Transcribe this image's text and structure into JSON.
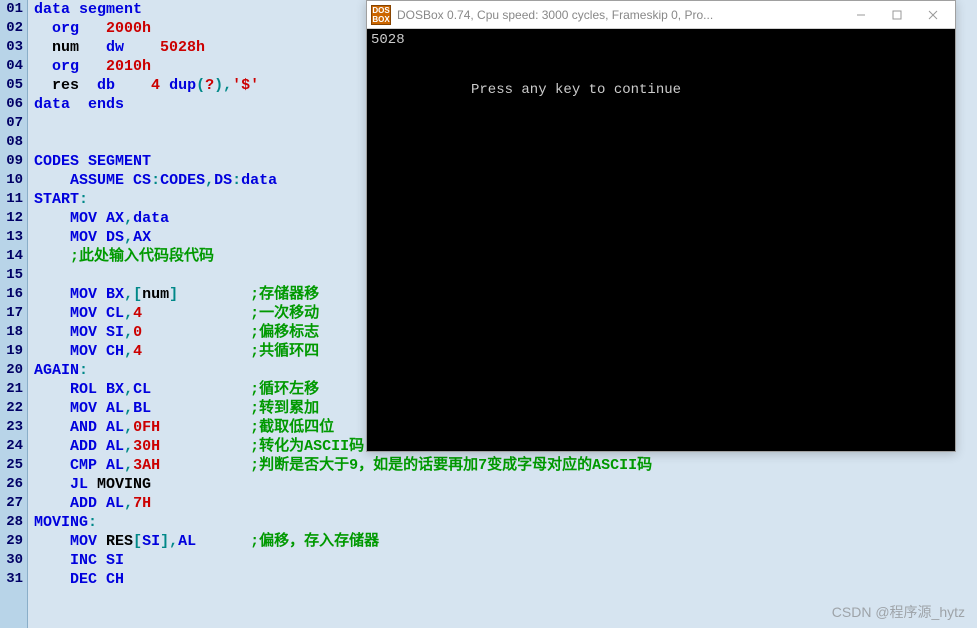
{
  "lines": [
    {
      "n": "01",
      "segs": [
        {
          "c": "kw-blue",
          "t": "data"
        },
        {
          "t": " "
        },
        {
          "c": "kw-blue",
          "t": "segment"
        }
      ]
    },
    {
      "n": "02",
      "segs": [
        {
          "t": "  "
        },
        {
          "c": "kw-blue",
          "t": "org"
        },
        {
          "t": "   "
        },
        {
          "c": "num-red",
          "t": "2000h"
        }
      ]
    },
    {
      "n": "03",
      "segs": [
        {
          "t": "  num   "
        },
        {
          "c": "kw-blue",
          "t": "dw"
        },
        {
          "t": "    "
        },
        {
          "c": "num-red",
          "t": "5028h"
        }
      ]
    },
    {
      "n": "04",
      "segs": [
        {
          "t": "  "
        },
        {
          "c": "kw-blue",
          "t": "org"
        },
        {
          "t": "   "
        },
        {
          "c": "num-red",
          "t": "2010h"
        }
      ]
    },
    {
      "n": "05",
      "segs": [
        {
          "t": "  res  "
        },
        {
          "c": "kw-blue",
          "t": "db"
        },
        {
          "t": "    "
        },
        {
          "c": "num-red",
          "t": "4"
        },
        {
          "t": " "
        },
        {
          "c": "kw-blue",
          "t": "dup"
        },
        {
          "c": "kw-teal",
          "t": "("
        },
        {
          "c": "str-red",
          "t": "?"
        },
        {
          "c": "kw-teal",
          "t": ")"
        },
        {
          "c": "kw-teal",
          "t": ","
        },
        {
          "c": "str-red",
          "t": "'$'"
        }
      ]
    },
    {
      "n": "06",
      "segs": [
        {
          "c": "kw-blue",
          "t": "data"
        },
        {
          "t": "  "
        },
        {
          "c": "kw-blue",
          "t": "ends"
        }
      ]
    },
    {
      "n": "07",
      "segs": [
        {
          "t": ""
        }
      ]
    },
    {
      "n": "08",
      "segs": [
        {
          "t": ""
        }
      ]
    },
    {
      "n": "09",
      "segs": [
        {
          "c": "kw-blue",
          "t": "CODES"
        },
        {
          "t": " "
        },
        {
          "c": "kw-blue",
          "t": "SEGMENT"
        }
      ]
    },
    {
      "n": "10",
      "segs": [
        {
          "t": "    "
        },
        {
          "c": "kw-blue",
          "t": "ASSUME"
        },
        {
          "t": " "
        },
        {
          "c": "kw-blue",
          "t": "CS"
        },
        {
          "c": "kw-teal",
          "t": ":"
        },
        {
          "c": "kw-blue",
          "t": "CODES"
        },
        {
          "c": "kw-teal",
          "t": ","
        },
        {
          "c": "kw-blue",
          "t": "DS"
        },
        {
          "c": "kw-teal",
          "t": ":"
        },
        {
          "c": "kw-blue",
          "t": "data"
        }
      ]
    },
    {
      "n": "11",
      "segs": [
        {
          "c": "kw-blue",
          "t": "START"
        },
        {
          "c": "kw-teal",
          "t": ":"
        }
      ]
    },
    {
      "n": "12",
      "segs": [
        {
          "t": "    "
        },
        {
          "c": "kw-blue",
          "t": "MOV"
        },
        {
          "t": " "
        },
        {
          "c": "kw-blue",
          "t": "AX"
        },
        {
          "c": "kw-teal",
          "t": ","
        },
        {
          "c": "kw-blue",
          "t": "data"
        }
      ]
    },
    {
      "n": "13",
      "segs": [
        {
          "t": "    "
        },
        {
          "c": "kw-blue",
          "t": "MOV"
        },
        {
          "t": " "
        },
        {
          "c": "kw-blue",
          "t": "DS"
        },
        {
          "c": "kw-teal",
          "t": ","
        },
        {
          "c": "kw-blue",
          "t": "AX"
        }
      ]
    },
    {
      "n": "14",
      "segs": [
        {
          "t": "    "
        },
        {
          "c": "cmt",
          "t": ";此处输入代码段代码"
        }
      ]
    },
    {
      "n": "15",
      "segs": [
        {
          "t": ""
        }
      ]
    },
    {
      "n": "16",
      "segs": [
        {
          "t": "    "
        },
        {
          "c": "kw-blue",
          "t": "MOV"
        },
        {
          "t": " "
        },
        {
          "c": "kw-blue",
          "t": "BX"
        },
        {
          "c": "kw-teal",
          "t": ",["
        },
        {
          "t": "num"
        },
        {
          "c": "kw-teal",
          "t": "]"
        },
        {
          "t": "        "
        },
        {
          "c": "cmt",
          "t": ";存储器移"
        }
      ]
    },
    {
      "n": "17",
      "segs": [
        {
          "t": "    "
        },
        {
          "c": "kw-blue",
          "t": "MOV"
        },
        {
          "t": " "
        },
        {
          "c": "kw-blue",
          "t": "CL"
        },
        {
          "c": "kw-teal",
          "t": ","
        },
        {
          "c": "num-red",
          "t": "4"
        },
        {
          "t": "            "
        },
        {
          "c": "cmt",
          "t": ";一次移动"
        }
      ]
    },
    {
      "n": "18",
      "segs": [
        {
          "t": "    "
        },
        {
          "c": "kw-blue",
          "t": "MOV"
        },
        {
          "t": " "
        },
        {
          "c": "kw-blue",
          "t": "SI"
        },
        {
          "c": "kw-teal",
          "t": ","
        },
        {
          "c": "num-red",
          "t": "0"
        },
        {
          "t": "            "
        },
        {
          "c": "cmt",
          "t": ";偏移标志"
        }
      ]
    },
    {
      "n": "19",
      "segs": [
        {
          "t": "    "
        },
        {
          "c": "kw-blue",
          "t": "MOV"
        },
        {
          "t": " "
        },
        {
          "c": "kw-blue",
          "t": "CH"
        },
        {
          "c": "kw-teal",
          "t": ","
        },
        {
          "c": "num-red",
          "t": "4"
        },
        {
          "t": "            "
        },
        {
          "c": "cmt",
          "t": ";共循环四"
        }
      ]
    },
    {
      "n": "20",
      "segs": [
        {
          "c": "kw-blue",
          "t": "AGAIN"
        },
        {
          "c": "kw-teal",
          "t": ":"
        }
      ]
    },
    {
      "n": "21",
      "segs": [
        {
          "t": "    "
        },
        {
          "c": "kw-blue",
          "t": "ROL"
        },
        {
          "t": " "
        },
        {
          "c": "kw-blue",
          "t": "BX"
        },
        {
          "c": "kw-teal",
          "t": ","
        },
        {
          "c": "kw-blue",
          "t": "CL"
        },
        {
          "t": "           "
        },
        {
          "c": "cmt",
          "t": ";循环左移"
        }
      ]
    },
    {
      "n": "22",
      "segs": [
        {
          "t": "    "
        },
        {
          "c": "kw-blue",
          "t": "MOV"
        },
        {
          "t": " "
        },
        {
          "c": "kw-blue",
          "t": "AL"
        },
        {
          "c": "kw-teal",
          "t": ","
        },
        {
          "c": "kw-blue",
          "t": "BL"
        },
        {
          "t": "           "
        },
        {
          "c": "cmt",
          "t": ";转到累加"
        }
      ]
    },
    {
      "n": "23",
      "segs": [
        {
          "t": "    "
        },
        {
          "c": "kw-blue",
          "t": "AND"
        },
        {
          "t": " "
        },
        {
          "c": "kw-blue",
          "t": "AL"
        },
        {
          "c": "kw-teal",
          "t": ","
        },
        {
          "c": "num-red",
          "t": "0FH"
        },
        {
          "t": "          "
        },
        {
          "c": "cmt",
          "t": ";截取低四位"
        }
      ]
    },
    {
      "n": "24",
      "segs": [
        {
          "t": "    "
        },
        {
          "c": "kw-blue",
          "t": "ADD"
        },
        {
          "t": " "
        },
        {
          "c": "kw-blue",
          "t": "AL"
        },
        {
          "c": "kw-teal",
          "t": ","
        },
        {
          "c": "num-red",
          "t": "30H"
        },
        {
          "t": "          "
        },
        {
          "c": "cmt",
          "t": ";转化为ASCII码"
        }
      ]
    },
    {
      "n": "25",
      "segs": [
        {
          "t": "    "
        },
        {
          "c": "kw-blue",
          "t": "CMP"
        },
        {
          "t": " "
        },
        {
          "c": "kw-blue",
          "t": "AL"
        },
        {
          "c": "kw-teal",
          "t": ","
        },
        {
          "c": "num-red",
          "t": "3AH"
        },
        {
          "t": "          "
        },
        {
          "c": "cmt",
          "t": ";判断是否大于9，如是的话要再加7变成字母对应的ASCII码"
        }
      ]
    },
    {
      "n": "26",
      "segs": [
        {
          "t": "    "
        },
        {
          "c": "kw-blue",
          "t": "JL"
        },
        {
          "t": " MOVING"
        }
      ]
    },
    {
      "n": "27",
      "segs": [
        {
          "t": "    "
        },
        {
          "c": "kw-blue",
          "t": "ADD"
        },
        {
          "t": " "
        },
        {
          "c": "kw-blue",
          "t": "AL"
        },
        {
          "c": "kw-teal",
          "t": ","
        },
        {
          "c": "num-red",
          "t": "7H"
        }
      ]
    },
    {
      "n": "28",
      "segs": [
        {
          "c": "kw-blue",
          "t": "MOVING"
        },
        {
          "c": "kw-teal",
          "t": ":"
        }
      ]
    },
    {
      "n": "29",
      "segs": [
        {
          "t": "    "
        },
        {
          "c": "kw-blue",
          "t": "MOV"
        },
        {
          "t": " RES"
        },
        {
          "c": "kw-teal",
          "t": "["
        },
        {
          "c": "kw-blue",
          "t": "SI"
        },
        {
          "c": "kw-teal",
          "t": "],"
        },
        {
          "c": "kw-blue",
          "t": "AL"
        },
        {
          "t": "      "
        },
        {
          "c": "cmt",
          "t": ";偏移，存入存储器"
        }
      ]
    },
    {
      "n": "30",
      "segs": [
        {
          "t": "    "
        },
        {
          "c": "kw-blue",
          "t": "INC"
        },
        {
          "t": " "
        },
        {
          "c": "kw-blue",
          "t": "SI"
        }
      ]
    },
    {
      "n": "31",
      "segs": [
        {
          "t": "    "
        },
        {
          "c": "kw-blue",
          "t": "DEC"
        },
        {
          "t": " "
        },
        {
          "c": "kw-blue",
          "t": "CH"
        }
      ]
    }
  ],
  "dosbox": {
    "title": "DOSBox 0.74, Cpu speed:    3000 cycles, Frameskip  0, Pro...",
    "output_line1": "5028",
    "output_line2": "Press any key to continue"
  },
  "watermark": "CSDN @程序源_hytz"
}
